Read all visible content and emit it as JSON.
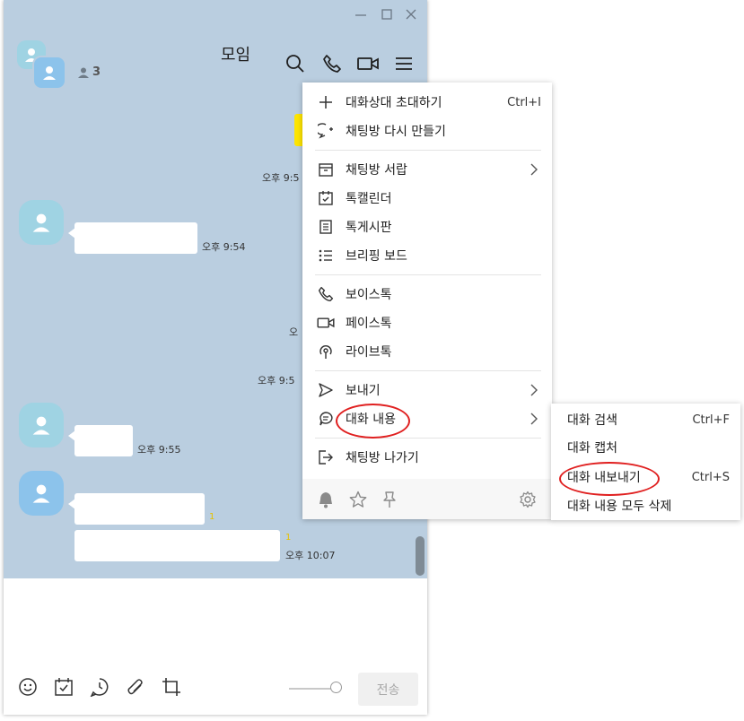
{
  "window": {
    "title": "모임",
    "member_count": "3"
  },
  "messages": {
    "times": [
      "오후 9:5",
      "오후 9:54",
      "오",
      "오후 9:5",
      "오후 9:55",
      "오후 10:07"
    ],
    "unread": [
      "1",
      "1"
    ]
  },
  "menu": {
    "invite": {
      "label": "대화상대 초대하기",
      "shortcut": "Ctrl+I"
    },
    "recreate": {
      "label": "채팅방 다시 만들기"
    },
    "drawer": {
      "label": "채팅방 서랍"
    },
    "calendar": {
      "label": "톡캘린더"
    },
    "board": {
      "label": "톡게시판"
    },
    "briefing": {
      "label": "브리핑 보드"
    },
    "voice": {
      "label": "보이스톡"
    },
    "face": {
      "label": "페이스톡"
    },
    "live": {
      "label": "라이브톡"
    },
    "send": {
      "label": "보내기"
    },
    "content": {
      "label": "대화 내용"
    },
    "leave": {
      "label": "채팅방 나가기"
    }
  },
  "submenu": {
    "search": {
      "label": "대화 검색",
      "shortcut": "Ctrl+F"
    },
    "capture": {
      "label": "대화 캡처"
    },
    "export": {
      "label": "대화 내보내기",
      "shortcut": "Ctrl+S"
    },
    "delete_all": {
      "label": "대화 내용 모두 삭제"
    }
  },
  "input": {
    "send_label": "전송"
  },
  "colors": {
    "chat_bg": "#bacee0",
    "highlight_circle": "#e02020",
    "unread": "#e6c100"
  }
}
